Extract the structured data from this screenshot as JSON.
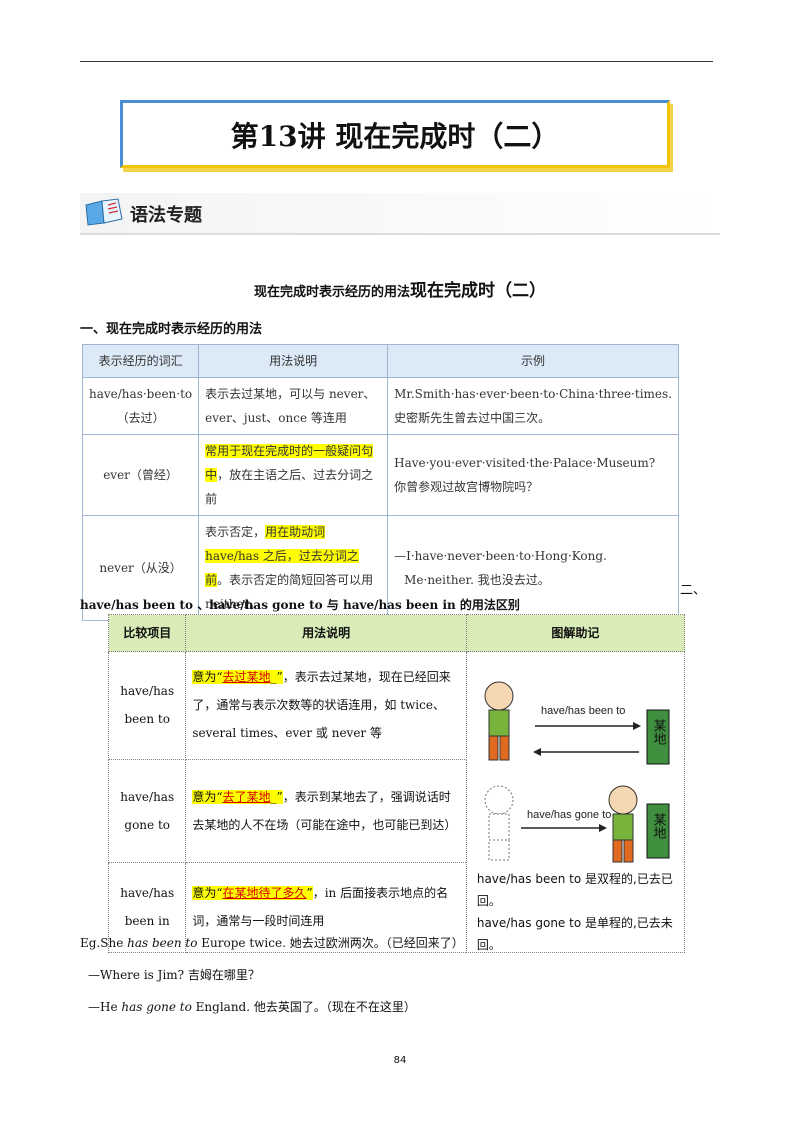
{
  "title": "第13讲  现在完成时（二）",
  "section_banner": "语法专题",
  "subtitle_small": "现在完成时表示经历的用法",
  "subtitle_big": "现在完成时（二）",
  "heading1": "一、现在完成时表示经历的用法",
  "table1": {
    "headers": [
      "表示经历的词汇",
      "用法说明",
      "示例"
    ],
    "rows": [
      {
        "word": "have/has·been·to",
        "word2": "（去过）",
        "usage": "表示去过某地，可以与 never、ever、just、once 等连用",
        "example": "Mr.Smith·has·ever·been·to·China·three·times.",
        "example_cn": "史密斯先生曾去过中国三次。"
      },
      {
        "word": "ever（曾经）",
        "usage_hl": "常用于现在完成时的一般疑问句中",
        "usage_rest": "，放在主语之后、过去分词之前",
        "example": "Have·you·ever·visited·the·Palace·Museum?",
        "example_cn": "你曾参观过故宫博物院吗？"
      },
      {
        "word": "never（从没）",
        "usage_pre": "表示否定，",
        "usage_hl": "用在助动词 have/has 之后，过去分词之前",
        "usage_rest": "。表示否定的简短回答可以用 neither。",
        "example": "—I·have·never·been·to·Hong·Kong.",
        "example_cn": "Me·neither. 我也没去过。"
      }
    ]
  },
  "section_two_mark": "二、",
  "heading2": "have/has been to 、have/has gone to 与 have/has been in 的用法区别",
  "table2": {
    "headers": [
      "比较项目",
      "用法说明",
      "图解助记"
    ],
    "rows": [
      {
        "item": "have/has been to",
        "meaning_pre": "意为“",
        "meaning": "去过某地",
        "meaning_post": "_”",
        "desc": "，表示去过某地，现在已经回来了，通常与表示次数等的状语连用，如 twice、several times、ever 或 never 等"
      },
      {
        "item": "have/has gone to",
        "meaning_pre": "意为“",
        "meaning": "去了某地",
        "meaning_post": "_”",
        "desc": "，表示到某地去了，强调说话时去某地的人不在场（可能在途中，也可能已到达）"
      },
      {
        "item": "have/has been in",
        "meaning_pre": "意为“",
        "meaning": "在某地待了多久",
        "meaning_post": "”",
        "desc": "，in 后面接表示地点的名词，通常与一段时间连用"
      }
    ],
    "diagram": {
      "label1": "have/has been to",
      "label2": "have/has gone to",
      "place": "某地",
      "caption1": "have/has been to 是双程的,已去已回。",
      "caption2": "have/has gone to 是单程的,已去未回。"
    }
  },
  "examples": [
    {
      "pre": "Eg.She ",
      "em": "has been to",
      "post": " Europe twice.  她去过欧洲两次。（已经回来了）"
    },
    {
      "pre": "—Where is Jim?  吉姆在哪里？",
      "em": "",
      "post": ""
    },
    {
      "pre": "—He ",
      "em": "has gone to",
      "post": " England.  他去英国了。（现在不在这里）"
    }
  ],
  "page_number": "84",
  "colors": {
    "highlight": "#ffff00",
    "title_border": "#f2c500",
    "table2_header": "#d9ecb8"
  }
}
